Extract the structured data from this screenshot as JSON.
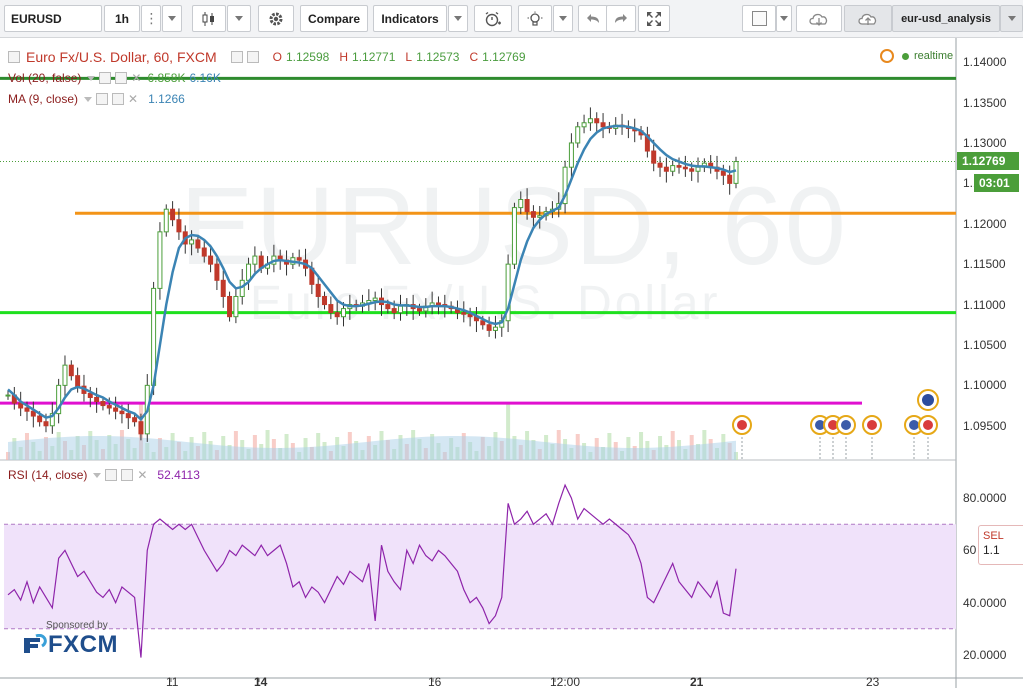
{
  "toolbar": {
    "symbol": "EURUSD",
    "interval": "1h",
    "compare_label": "Compare",
    "indicators_label": "Indicators",
    "layout_name": "eur-usd_analysis"
  },
  "legend": {
    "title": "Euro Fx/U.S. Dollar, 60, FXCM",
    "ohlc": {
      "o_label": "O",
      "o": "1.12598",
      "h_label": "H",
      "h": "1.12771",
      "l_label": "L",
      "l": "1.12573",
      "c_label": "C",
      "c": "1.12769"
    },
    "volume": {
      "name": "Vol (20, false)",
      "value1": "6.858K",
      "value2": "6.16K"
    },
    "ma": {
      "name": "MA (9, close)",
      "value": "1.1266"
    },
    "realtime": "realtime"
  },
  "watermark": {
    "line1": "EURUSD, 60",
    "line2": "Euro Fx/U.S. Dollar"
  },
  "price_axis": {
    "labels": [
      "1.14000",
      "1.13500",
      "1.13000",
      "1.12500",
      "1.12000",
      "1.11500",
      "1.11000",
      "1.10500",
      "1.10000",
      "1.09500"
    ],
    "current_price": "1.12769",
    "countdown": "03:01"
  },
  "rsi": {
    "name": "RSI (14, close)",
    "value": "52.4113",
    "labels": [
      "80.0000",
      "60",
      "40.0000",
      "20.0000"
    ]
  },
  "time_axis": {
    "labels": [
      {
        "text": "11",
        "bold": false
      },
      {
        "text": "14",
        "bold": true
      },
      {
        "text": "16",
        "bold": false
      },
      {
        "text": "12:00",
        "bold": false
      },
      {
        "text": "21",
        "bold": true
      },
      {
        "text": "23",
        "bold": false
      }
    ]
  },
  "sponsor": {
    "small": "Sponsored by",
    "brand": "FXCM"
  },
  "sell_box": {
    "label": "SEL",
    "value": "1.1"
  },
  "colors": {
    "ma_line": "#3b84b4",
    "rsi_line": "#8e24aa",
    "rsi_band": "#f0e2fa",
    "resistance_top": "#2e8b2e",
    "level_orange": "#f39417",
    "level_green": "#1ee01e",
    "level_magenta": "#e010d0",
    "candle_up": "#4b9e3a",
    "candle_down": "#c0392b"
  },
  "chart_data": {
    "type": "candlestick",
    "ylim": [
      1.092,
      1.142
    ],
    "horizontal_levels": [
      1.138,
      1.1213,
      1.109,
      1.0978
    ],
    "price_path": [
      1.0988,
      1.0978,
      1.0972,
      1.0968,
      1.0962,
      1.0955,
      1.095,
      1.0965,
      1.1,
      1.1025,
      1.1012,
      1.0999,
      1.099,
      1.0985,
      1.098,
      1.0975,
      1.0972,
      1.0968,
      1.0965,
      1.096,
      1.0955,
      1.094,
      1.1,
      1.112,
      1.119,
      1.1218,
      1.1205,
      1.119,
      1.1175,
      1.118,
      1.117,
      1.116,
      1.115,
      1.113,
      1.111,
      1.1085,
      1.111,
      1.113,
      1.115,
      1.116,
      1.1145,
      1.115,
      1.116,
      1.1155,
      1.115,
      1.1158,
      1.1155,
      1.1145,
      1.1125,
      1.111,
      1.11,
      1.109,
      1.1085,
      1.1095,
      1.11,
      1.1098,
      1.1102,
      1.1105,
      1.1108,
      1.11,
      1.1095,
      1.109,
      1.1098,
      1.11,
      1.1095,
      1.1092,
      1.1098,
      1.1102,
      1.11,
      1.1098,
      1.1095,
      1.109,
      1.1088,
      1.1085,
      1.108,
      1.1075,
      1.1068,
      1.1072,
      1.108,
      1.115,
      1.122,
      1.123,
      1.1215,
      1.1208,
      1.121,
      1.1215,
      1.1218,
      1.1225,
      1.127,
      1.13,
      1.132,
      1.1325,
      1.133,
      1.1325,
      1.132,
      1.1318,
      1.1322,
      1.132,
      1.1318,
      1.1315,
      1.131,
      1.129,
      1.1275,
      1.127,
      1.1265,
      1.1272,
      1.127,
      1.1268,
      1.1265,
      1.127,
      1.1275,
      1.127,
      1.1265,
      1.126,
      1.125,
      1.1277
    ],
    "ma_path": [
      1.0995,
      1.0988,
      1.098,
      1.0975,
      1.097,
      1.0965,
      1.096,
      1.0962,
      1.0972,
      1.0985,
      1.0995,
      1.0998,
      1.0996,
      1.0992,
      1.0988,
      1.0985,
      1.098,
      1.0976,
      1.0972,
      1.0968,
      1.0965,
      1.0958,
      1.0968,
      1.1,
      1.105,
      1.11,
      1.114,
      1.117,
      1.1182,
      1.1186,
      1.1185,
      1.118,
      1.1172,
      1.116,
      1.1145,
      1.1128,
      1.112,
      1.1122,
      1.1128,
      1.1138,
      1.1145,
      1.115,
      1.1154,
      1.1155,
      1.1154,
      1.1153,
      1.1152,
      1.115,
      1.1145,
      1.1135,
      1.1125,
      1.1115,
      1.1105,
      1.11,
      1.1098,
      1.1098,
      1.1099,
      1.1101,
      1.1103,
      1.1104,
      1.1103,
      1.11,
      1.1099,
      1.1099,
      1.1098,
      1.1097,
      1.1097,
      1.1098,
      1.1098,
      1.1098,
      1.1097,
      1.1095,
      1.1093,
      1.109,
      1.1086,
      1.1082,
      1.1078,
      1.1076,
      1.1078,
      1.1095,
      1.1125,
      1.1155,
      1.1178,
      1.1195,
      1.1205,
      1.1212,
      1.1216,
      1.122,
      1.1235,
      1.1255,
      1.1275,
      1.1292,
      1.1305,
      1.1313,
      1.1318,
      1.132,
      1.1321,
      1.1321,
      1.132,
      1.1318,
      1.1315,
      1.1308,
      1.13,
      1.1292,
      1.1285,
      1.128,
      1.1277,
      1.1274,
      1.1272,
      1.1271,
      1.1271,
      1.127,
      1.1269,
      1.1267,
      1.1264,
      1.1266
    ],
    "rsi_ylim": [
      15,
      90
    ],
    "rsi_band": [
      30,
      70
    ],
    "rsi_path": [
      43,
      45,
      41,
      48,
      40,
      46,
      42,
      38,
      57,
      60,
      55,
      50,
      52,
      48,
      44,
      42,
      45,
      40,
      46,
      44,
      42,
      19,
      60,
      70,
      72,
      70,
      68,
      70,
      68,
      70,
      65,
      60,
      56,
      52,
      55,
      60,
      58,
      62,
      60,
      58,
      62,
      58,
      60,
      62,
      55,
      46,
      48,
      42,
      46,
      44,
      40,
      45,
      50,
      47,
      52,
      50,
      48,
      55,
      33,
      62,
      52,
      48,
      45,
      60,
      55,
      62,
      58,
      56,
      60,
      58,
      55,
      52,
      45,
      40,
      42,
      38,
      32,
      35,
      42,
      78,
      70,
      72,
      75,
      70,
      72,
      74,
      70,
      78,
      85,
      80,
      72,
      76,
      74,
      72,
      70,
      72,
      70,
      68,
      66,
      62,
      55,
      42,
      40,
      45,
      50,
      55,
      48,
      45,
      42,
      48,
      45,
      42,
      48,
      36,
      35,
      53
    ]
  }
}
